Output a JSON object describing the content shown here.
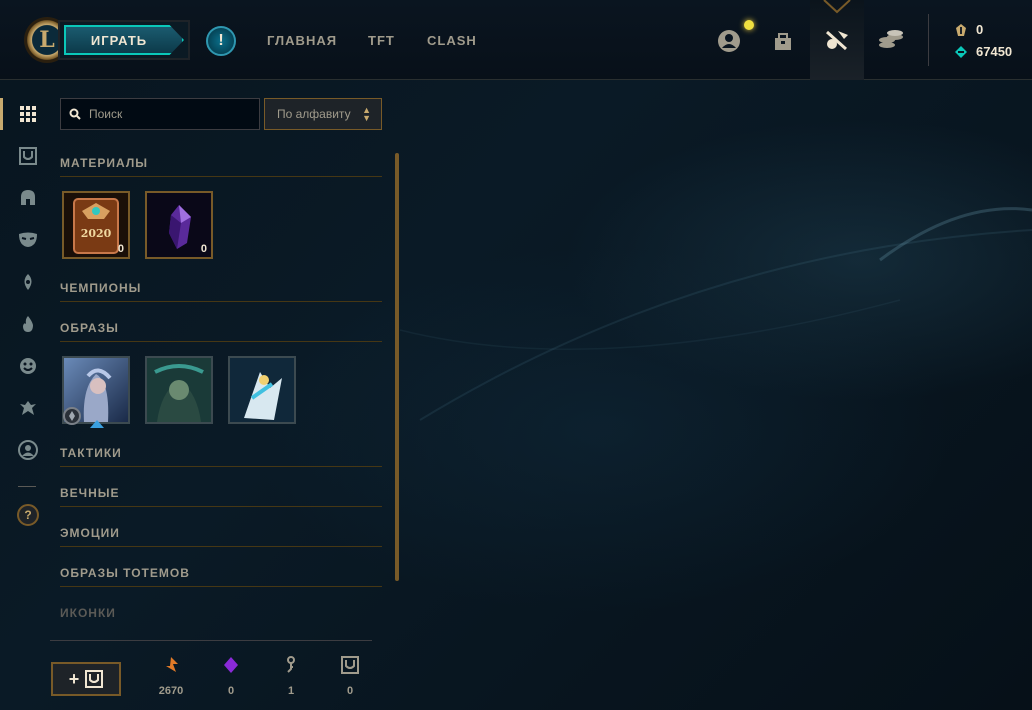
{
  "topbar": {
    "logo_letter": "L",
    "play_label": "ИГРАТЬ",
    "alert_label": "!",
    "nav": [
      "ГЛАВНАЯ",
      "TFT",
      "CLASH"
    ],
    "icons": [
      "profile-icon",
      "inventory-bag-icon",
      "loot-crafting-icon",
      "store-coins-icon"
    ],
    "currency": [
      {
        "name": "blue-essence-icon",
        "value": "0"
      },
      {
        "name": "riot-points-icon",
        "value": "67450"
      }
    ]
  },
  "sidebar": {
    "icons": [
      "all-items-grid-icon",
      "chest-icon",
      "champion-helmet-icon",
      "skin-mask-icon",
      "ward-icon",
      "emote-flame-icon",
      "emote-face-icon",
      "summoner-icon",
      "profile-circle-icon"
    ],
    "help_label": "?"
  },
  "search": {
    "placeholder": "Поиск"
  },
  "sort": {
    "label": "По алфавиту"
  },
  "sections": {
    "materials": "МАТЕРИАЛЫ",
    "champions": "ЧЕМПИОНЫ",
    "skins": "ОБРАЗЫ",
    "tactics": "ТАКТИКИ",
    "eternals": "ВЕЧНЫЕ",
    "emotes": "ЭМОЦИИ",
    "totems": "ОБРАЗЫ ТОТЕМОВ",
    "icons": "ИКОНКИ"
  },
  "materials": [
    {
      "name": "event-pass-2020",
      "label": "2020",
      "count": "0"
    },
    {
      "name": "mythic-essence-crystal",
      "count": "0"
    }
  ],
  "bottom": {
    "craft_label": "+",
    "resources": [
      {
        "name": "orange-essence-icon",
        "value": "2670"
      },
      {
        "name": "mythic-essence-icon",
        "value": "0"
      },
      {
        "name": "key-icon",
        "value": "1"
      },
      {
        "name": "chest-icon",
        "value": "0"
      }
    ]
  },
  "colors": {
    "gold": "#c8aa6e",
    "teal": "#0ac8b9",
    "background": "#010a13"
  }
}
